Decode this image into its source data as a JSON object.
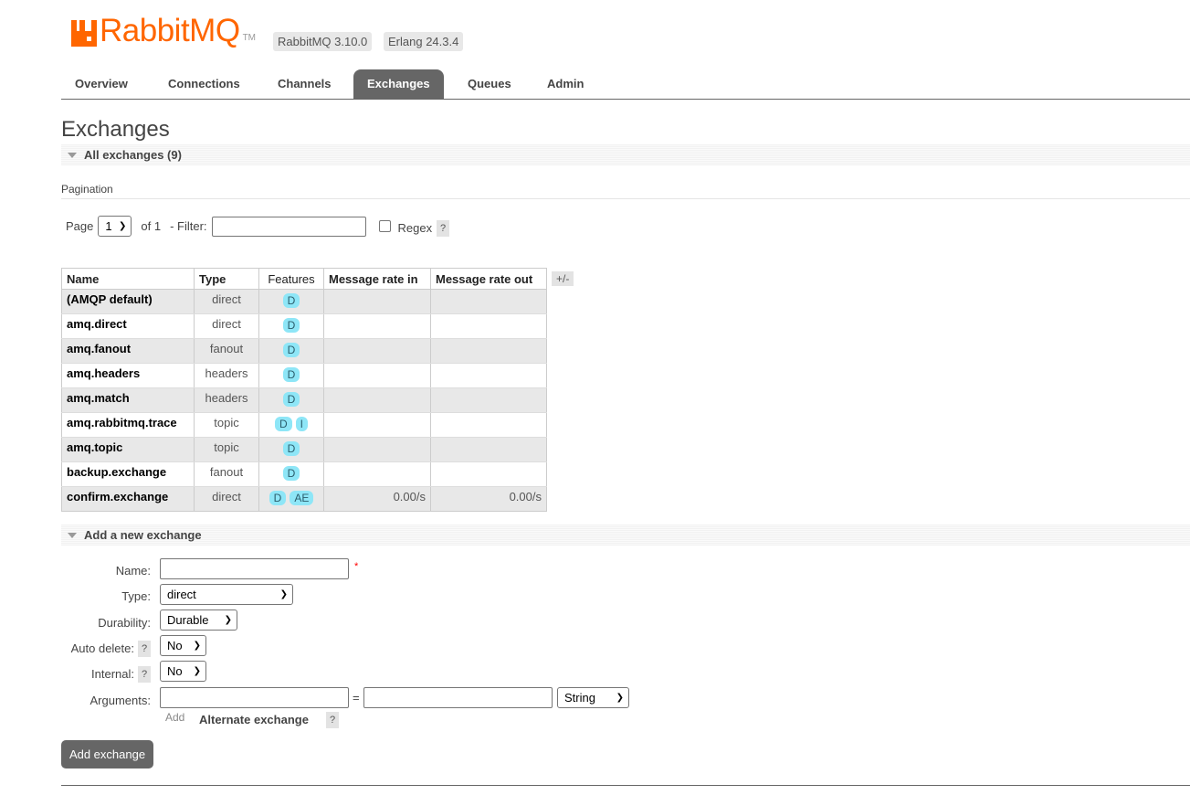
{
  "header": {
    "logo_text": "RabbitMQ",
    "logo_tm": "TM",
    "rabbitmq_version": "RabbitMQ 3.10.0",
    "erlang_version": "Erlang 24.3.4",
    "brand_color": "#ff6600"
  },
  "nav": {
    "items": [
      {
        "label": "Overview"
      },
      {
        "label": "Connections"
      },
      {
        "label": "Channels"
      },
      {
        "label": "Exchanges",
        "active": true
      },
      {
        "label": "Queues"
      },
      {
        "label": "Admin"
      }
    ]
  },
  "page_title": "Exchanges",
  "all_exchanges": {
    "title": "All exchanges (9)"
  },
  "pagination": {
    "label": "Pagination",
    "page_label": "Page",
    "page_value": "1",
    "of_label": "of 1",
    "filter_label": "- Filter:",
    "filter_value": "",
    "regex_label": "Regex",
    "regex_checked": false,
    "help": "?"
  },
  "table": {
    "headers": [
      "Name",
      "Type",
      "Features",
      "Message rate in",
      "Message rate out"
    ],
    "col_toggle": "+/-",
    "rows": [
      {
        "name": "(AMQP default)",
        "type": "direct",
        "features": [
          "D"
        ],
        "rate_in": "",
        "rate_out": ""
      },
      {
        "name": "amq.direct",
        "type": "direct",
        "features": [
          "D"
        ],
        "rate_in": "",
        "rate_out": ""
      },
      {
        "name": "amq.fanout",
        "type": "fanout",
        "features": [
          "D"
        ],
        "rate_in": "",
        "rate_out": ""
      },
      {
        "name": "amq.headers",
        "type": "headers",
        "features": [
          "D"
        ],
        "rate_in": "",
        "rate_out": ""
      },
      {
        "name": "amq.match",
        "type": "headers",
        "features": [
          "D"
        ],
        "rate_in": "",
        "rate_out": ""
      },
      {
        "name": "amq.rabbitmq.trace",
        "type": "topic",
        "features": [
          "D",
          "I"
        ],
        "rate_in": "",
        "rate_out": ""
      },
      {
        "name": "amq.topic",
        "type": "topic",
        "features": [
          "D"
        ],
        "rate_in": "",
        "rate_out": ""
      },
      {
        "name": "backup.exchange",
        "type": "fanout",
        "features": [
          "D"
        ],
        "rate_in": "",
        "rate_out": ""
      },
      {
        "name": "confirm.exchange",
        "type": "direct",
        "features": [
          "D",
          "AE"
        ],
        "rate_in": "0.00/s",
        "rate_out": "0.00/s"
      }
    ]
  },
  "add_exchange": {
    "title": "Add a new exchange",
    "name_label": "Name:",
    "name_value": "",
    "required_mark": "*",
    "type_label": "Type:",
    "type_value": "direct",
    "durability_label": "Durability:",
    "durability_value": "Durable",
    "auto_delete_label": "Auto delete:",
    "auto_delete_value": "No",
    "internal_label": "Internal:",
    "internal_value": "No",
    "arguments_label": "Arguments:",
    "arg_equals": "=",
    "arg_type_value": "String",
    "add_link": "Add",
    "alternate_exchange": "Alternate exchange",
    "help": "?",
    "submit_label": "Add exchange"
  },
  "icons": {
    "collapse": "triangle-down-icon",
    "chevron": "chevron-down-icon"
  }
}
